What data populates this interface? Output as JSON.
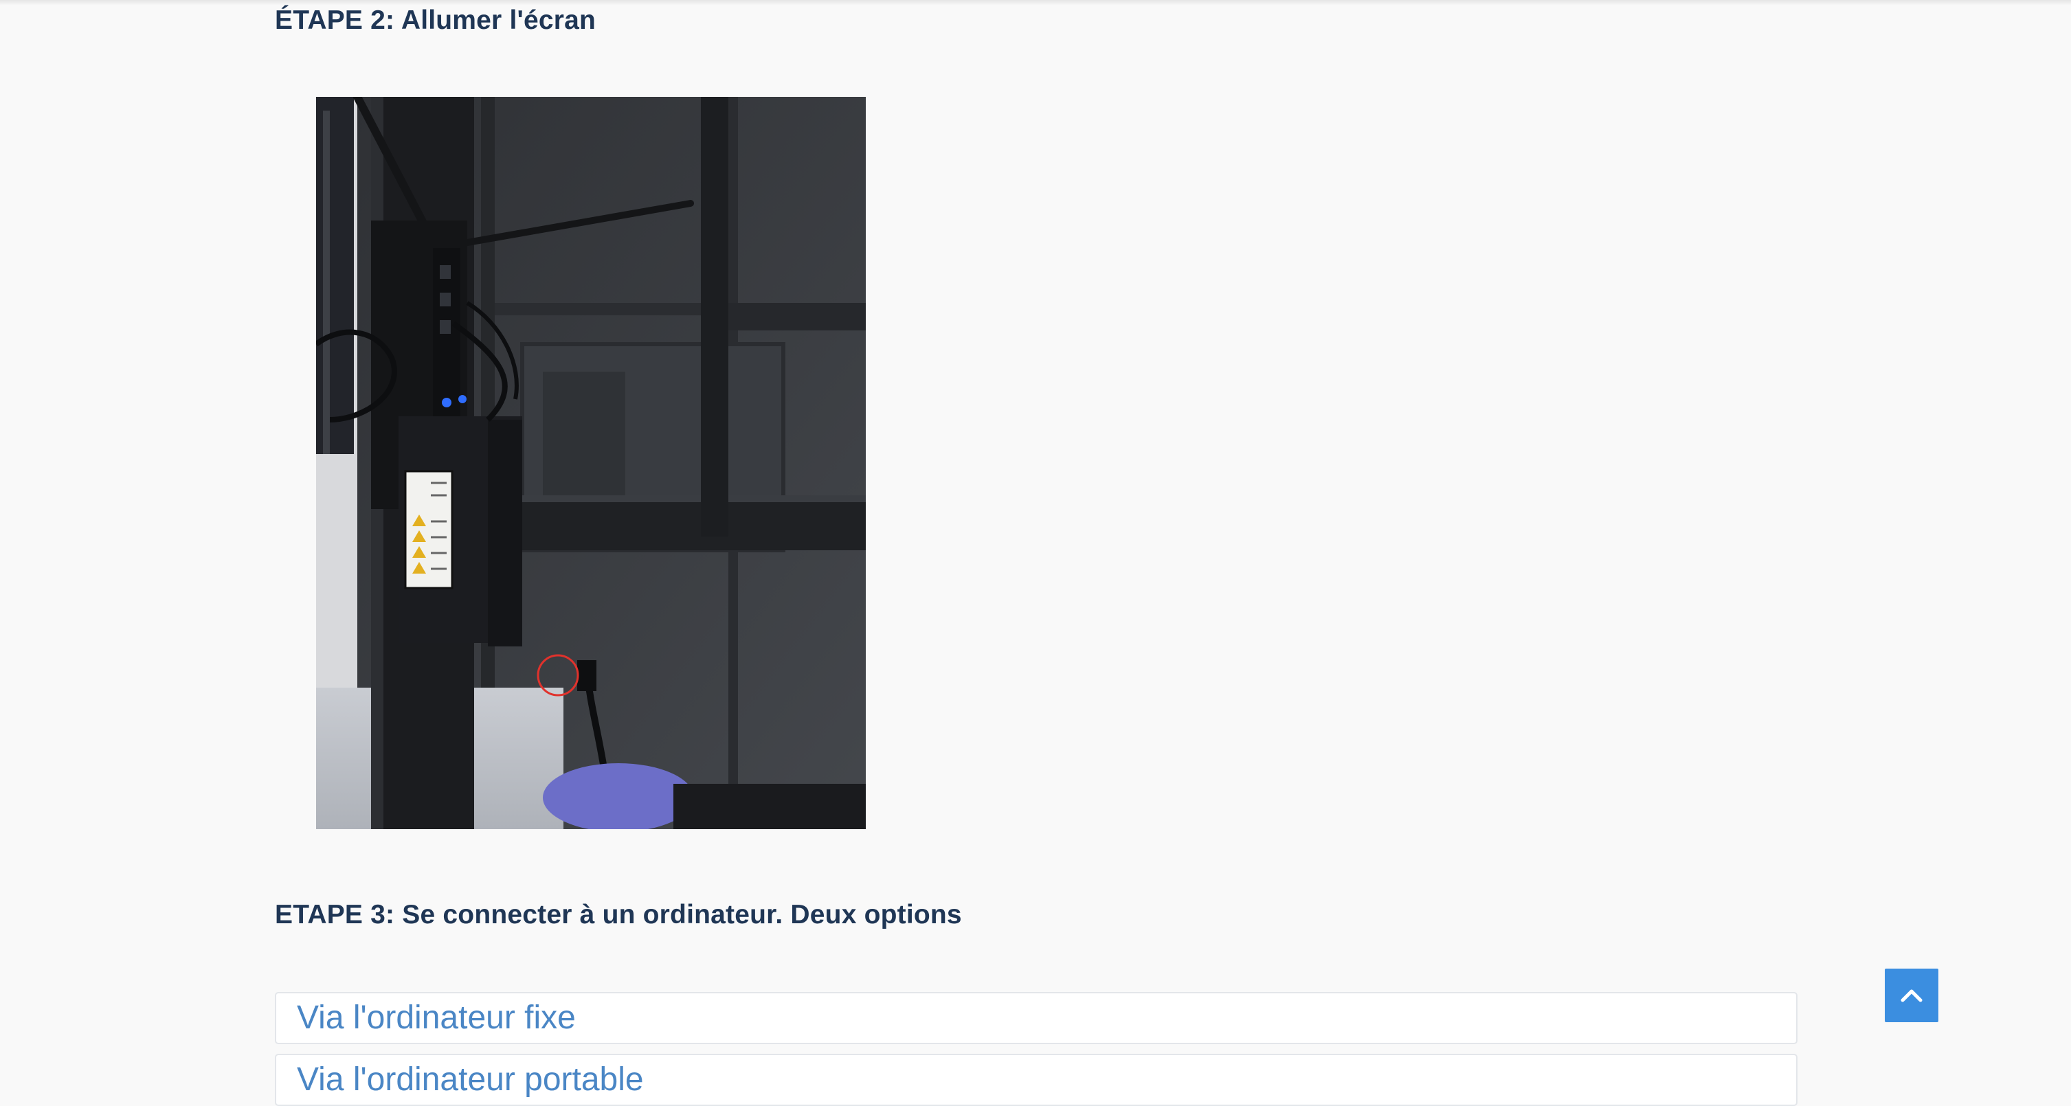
{
  "steps": {
    "step2_title": "ÉTAPE 2: Allumer l'écran",
    "step3_title": "ETAPE 3: Se connecter à un ordinateur. Deux options"
  },
  "accordion": {
    "items": [
      {
        "label": "Via l'ordinateur fixe"
      },
      {
        "label": "Via l'ordinateur portable"
      }
    ]
  },
  "icons": {
    "back_to_top": "chevron-up-icon"
  },
  "colors": {
    "heading": "#1f3655",
    "link": "#4a86c5",
    "accent": "#3b8ee0",
    "page_background": "#f9f9f9"
  }
}
